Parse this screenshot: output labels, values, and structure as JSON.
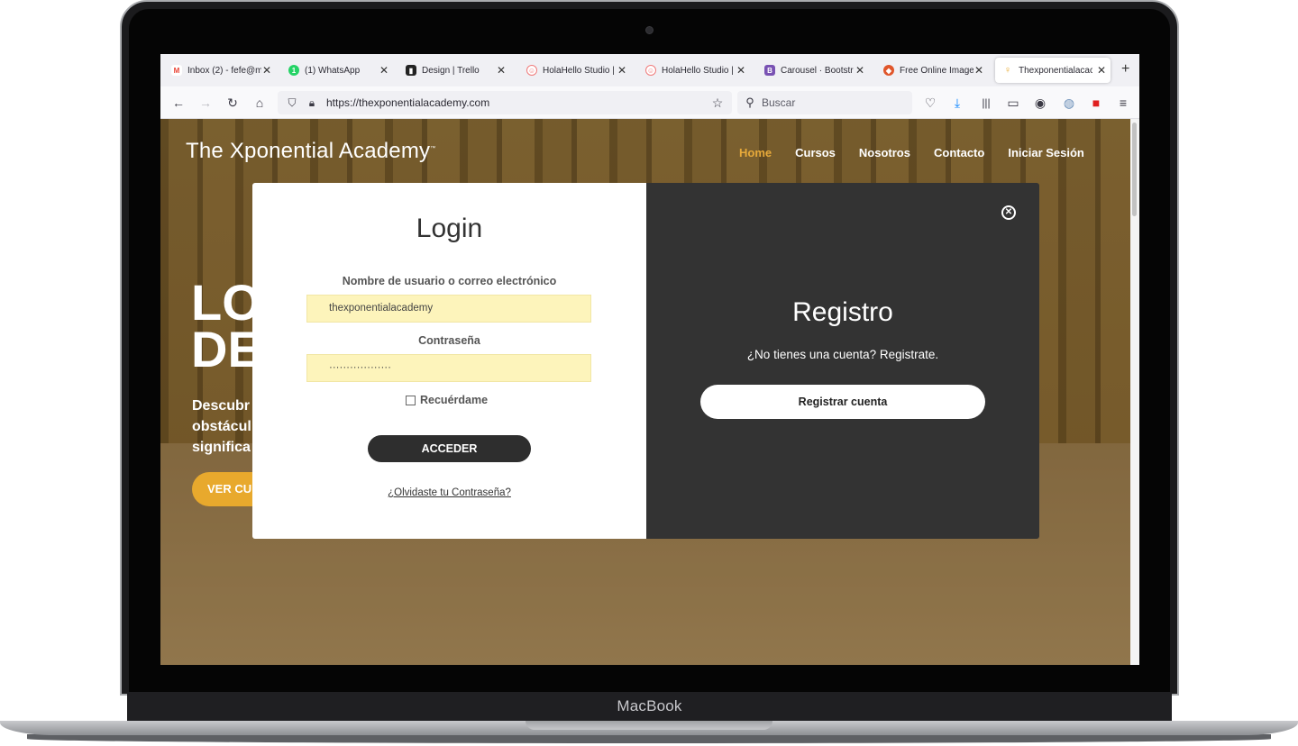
{
  "device": {
    "label": "MacBook"
  },
  "browser": {
    "tabs": [
      {
        "title": "Inbox (2) - fefe@m",
        "icon": "gmail-icon",
        "icon_color": "#ea4335",
        "icon_glyph": "M"
      },
      {
        "title": "(1) WhatsApp",
        "icon": "whatsapp-icon",
        "icon_color": "#25d366",
        "icon_glyph": "1"
      },
      {
        "title": "Design | Trello",
        "icon": "trello-icon",
        "icon_color": "#222222",
        "icon_glyph": "▮"
      },
      {
        "title": "HolaHello Studio |",
        "icon": "holahello-icon",
        "icon_color": "#f07b7b",
        "icon_glyph": "☺"
      },
      {
        "title": "HolaHello Studio |",
        "icon": "holahello-icon",
        "icon_color": "#f07b7b",
        "icon_glyph": "☺"
      },
      {
        "title": "Carousel · Bootstr",
        "icon": "bootstrap-icon",
        "icon_color": "#7952b3",
        "icon_glyph": "B"
      },
      {
        "title": "Free Online Image",
        "icon": "image-tool-icon",
        "icon_color": "#e0562b",
        "icon_glyph": "◆"
      },
      {
        "title": "Thexponentialacac",
        "icon": "bulb-icon",
        "icon_color": "#e8a92d",
        "icon_glyph": "♀"
      }
    ],
    "active_tab_index": 7,
    "url": "https://thexponentialacademy.com",
    "search_placeholder": "Buscar"
  },
  "site": {
    "logo": "The Xponential Academy",
    "logo_mark": "™",
    "nav": [
      "Home",
      "Cursos",
      "Nosotros",
      "Contacto",
      "Iniciar Sesión"
    ],
    "nav_active": "Home",
    "hero_title_line1": "LO",
    "hero_title_line2": "DE",
    "hero_sub_line1": "Descubr",
    "hero_sub_line2": "obstácul",
    "hero_sub_line3": "significa",
    "hero_button": "VER CU",
    "accent_color": "#e8a92d"
  },
  "login": {
    "title": "Login",
    "username_label": "Nombre de usuario o correo electrónico",
    "username_value": "thexponentialacademy",
    "password_label": "Contraseña",
    "password_value": "··················",
    "remember_label": "Recuérdame",
    "submit_label": "ACCEDER",
    "forgot_label": "¿Olvidaste tu Contraseña?"
  },
  "register": {
    "title": "Registro",
    "subtitle": "¿No tienes una cuenta? Registrate.",
    "button_label": "Registrar cuenta"
  }
}
